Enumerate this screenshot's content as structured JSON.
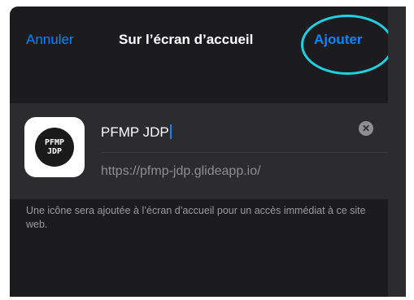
{
  "nav": {
    "cancel_label": "Annuler",
    "title": "Sur l’écran d’accueil",
    "add_label": "Ajouter"
  },
  "app": {
    "icon_text_line1": "PFMP",
    "icon_text_line2": "JDP",
    "name_value": "PFMP JDP",
    "url": "https://pfmp-jdp.glideapp.io/"
  },
  "note": "Une icône sera ajoutée à l’écran d’accueil pour un accès immédiat à ce site web.",
  "colors": {
    "accent": "#0a84ff",
    "highlight": "#1fd1e0",
    "background": "#1c1c1e",
    "card": "#2c2c2e"
  },
  "icons": {
    "clear": "x-circle-icon"
  }
}
